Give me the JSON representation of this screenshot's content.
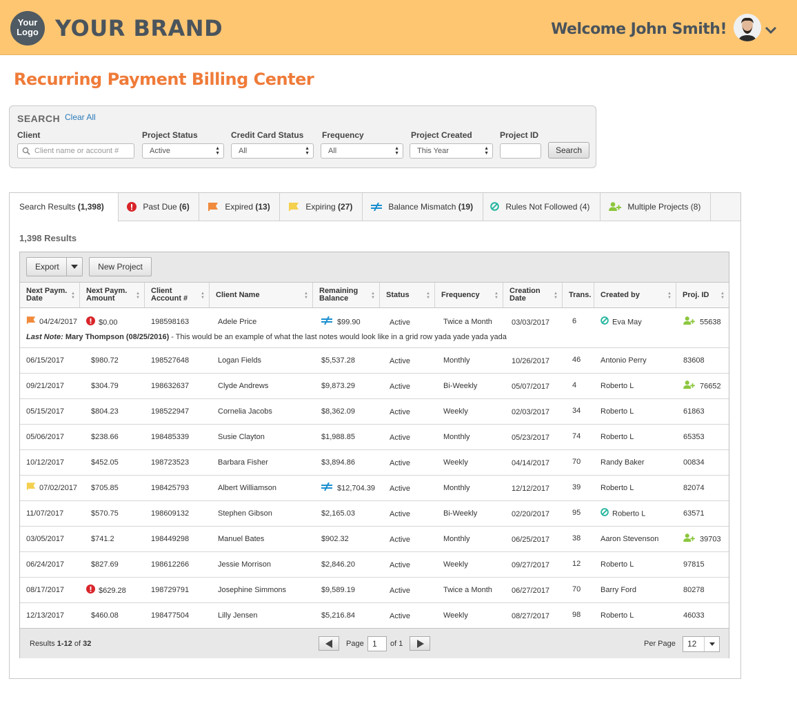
{
  "header": {
    "logo_line1": "Your",
    "logo_line2": "Logo",
    "brand": "YOUR BRAND",
    "welcome": "Welcome John Smith!"
  },
  "page_title": "Recurring Payment Billing Center",
  "search": {
    "title": "SEARCH",
    "clear_all": "Clear All",
    "client_label": "Client",
    "client_placeholder": "Client name or account #",
    "project_status_label": "Project Status",
    "project_status_value": "Active",
    "cc_status_label": "Credit Card Status",
    "cc_status_value": "All",
    "frequency_label": "Frequency",
    "frequency_value": "All",
    "project_created_label": "Project Created",
    "project_created_value": "This Year",
    "project_id_label": "Project ID",
    "project_id_value": "",
    "search_button": "Search"
  },
  "tabs": [
    {
      "label": "Search Results",
      "count": "(1,398)"
    },
    {
      "label": "Past Due",
      "count": "(6)"
    },
    {
      "label": "Expired",
      "count": "(13)"
    },
    {
      "label": "Expiring",
      "count": "(27)"
    },
    {
      "label": "Balance Mismatch",
      "count": "(19)"
    },
    {
      "label": "Rules Not Followed",
      "count": "(4)"
    },
    {
      "label": "Multiple Projects",
      "count": "(8)"
    }
  ],
  "results_count": "1,398 Results",
  "toolbar": {
    "export": "Export",
    "new_project": "New Project"
  },
  "columns": [
    {
      "l1": "Next Paym.",
      "l2": "Date"
    },
    {
      "l1": "Next Paym.",
      "l2": "Amount"
    },
    {
      "l1": "Client",
      "l2": "Account #"
    },
    {
      "l1": "Client Name",
      "l2": ""
    },
    {
      "l1": "Remaining",
      "l2": "Balance"
    },
    {
      "l1": "Status",
      "l2": ""
    },
    {
      "l1": "Frequency",
      "l2": ""
    },
    {
      "l1": "Creation",
      "l2": "Date"
    },
    {
      "l1": "Trans.",
      "l2": ""
    },
    {
      "l1": "Created by",
      "l2": ""
    },
    {
      "l1": "Proj. ID",
      "l2": ""
    }
  ],
  "rows": [
    {
      "date": "04/24/2017",
      "amount": "$0.00",
      "account": "198598163",
      "client": "Adele Price",
      "balance": "$99.90",
      "status": "Active",
      "frequency": "Twice a Month",
      "created": "03/03/2017",
      "trans": "6",
      "created_by": "Eva May",
      "proj_id": "55638",
      "date_icon": "flag-orange",
      "amount_icon": "alert",
      "balance_icon": "mismatch",
      "creator_icon": "rules",
      "proj_icon": "multi",
      "note_label": "Last Note:",
      "note_author": "Mary Thompson (08/25/2016)",
      "note_text": " - This would be an example of what the last notes would look like in a grid row yada yade yada yada"
    },
    {
      "date": "06/15/2017",
      "amount": "$980.72",
      "account": "198527648",
      "client": "Logan Fields",
      "balance": "$5,537.28",
      "status": "Active",
      "frequency": "Monthly",
      "created": "10/26/2017",
      "trans": "46",
      "created_by": "Antonio Perry",
      "proj_id": "83608"
    },
    {
      "date": "09/21/2017",
      "amount": "$304.79",
      "account": "198632637",
      "client": "Clyde Andrews",
      "balance": "$9,873.29",
      "status": "Active",
      "frequency": "Bi-Weekly",
      "created": "05/07/2017",
      "trans": "4",
      "created_by": "Roberto L",
      "proj_id": "76652",
      "proj_icon": "multi"
    },
    {
      "date": "05/15/2017",
      "amount": "$804.23",
      "account": "198522947",
      "client": "Cornelia Jacobs",
      "balance": "$8,362.09",
      "status": "Active",
      "frequency": "Weekly",
      "created": "02/03/2017",
      "trans": "34",
      "created_by": "Roberto L",
      "proj_id": "61863"
    },
    {
      "date": "05/06/2017",
      "amount": "$238.66",
      "account": "198485339",
      "client": "Susie Clayton",
      "balance": "$1,988.85",
      "status": "Active",
      "frequency": "Monthly",
      "created": "05/23/2017",
      "trans": "74",
      "created_by": "Roberto L",
      "proj_id": "65353"
    },
    {
      "date": "10/12/2017",
      "amount": "$452.05",
      "account": "198723523",
      "client": "Barbara Fisher",
      "balance": "$3,894.86",
      "status": "Active",
      "frequency": "Weekly",
      "created": "04/14/2017",
      "trans": "70",
      "created_by": "Randy Baker",
      "proj_id": "00834"
    },
    {
      "date": "07/02/2017",
      "amount": "$705.85",
      "account": "198425793",
      "client": "Albert Williamson",
      "balance": "$12,704.39",
      "status": "Active",
      "frequency": "Monthly",
      "created": "12/12/2017",
      "trans": "39",
      "created_by": "Roberto L",
      "proj_id": "82074",
      "date_icon": "flag-yellow",
      "balance_icon": "mismatch"
    },
    {
      "date": "11/07/2017",
      "amount": "$570.75",
      "account": "198609132",
      "client": "Stephen Gibson",
      "balance": "$2,165.03",
      "status": "Active",
      "frequency": "Bi-Weekly",
      "created": "02/20/2017",
      "trans": "95",
      "created_by": "Roberto L",
      "proj_id": "63571",
      "creator_icon": "rules"
    },
    {
      "date": "03/05/2017",
      "amount": "$741.2",
      "account": "198449298",
      "client": "Manuel Bates",
      "balance": "$902.32",
      "status": "Active",
      "frequency": "Monthly",
      "created": "06/25/2017",
      "trans": "38",
      "created_by": "Aaron Stevenson",
      "proj_id": "39703",
      "proj_icon": "multi"
    },
    {
      "date": "06/24/2017",
      "amount": "$827.69",
      "account": "198612266",
      "client": "Jessie Morrison",
      "balance": "$2,846.20",
      "status": "Active",
      "frequency": "Weekly",
      "created": "09/27/2017",
      "trans": "12",
      "created_by": "Roberto L",
      "proj_id": "97815"
    },
    {
      "date": "08/17/2017",
      "amount": "$629.28",
      "account": "198729791",
      "client": "Josephine Simmons",
      "balance": "$9,589.19",
      "status": "Active",
      "frequency": "Twice a Month",
      "created": "06/27/2017",
      "trans": "70",
      "created_by": "Barry Ford",
      "proj_id": "80278",
      "amount_icon": "alert"
    },
    {
      "date": "12/13/2017",
      "amount": "$460.08",
      "account": "198477504",
      "client": "Lilly Jensen",
      "balance": "$5,216.84",
      "status": "Active",
      "frequency": "Weekly",
      "created": "08/27/2017",
      "trans": "98",
      "created_by": "Roberto L",
      "proj_id": "46033"
    }
  ],
  "footer": {
    "results_prefix": "Results ",
    "results_range": "1-12",
    "results_of": " of ",
    "results_total": "32",
    "page_label": "Page",
    "page_value": "1",
    "of_pages": "of 1",
    "per_page_label": "Per Page",
    "per_page_value": "12"
  },
  "colors": {
    "header_bg": "#ffc671",
    "title": "#ef7b39",
    "alert_red": "#d9252a",
    "flag_orange": "#f08a3c",
    "flag_yellow": "#f4d04e",
    "mismatch_blue": "#1b8fcf",
    "rules_teal": "#26b5a0",
    "multi_green": "#8cc63e"
  }
}
